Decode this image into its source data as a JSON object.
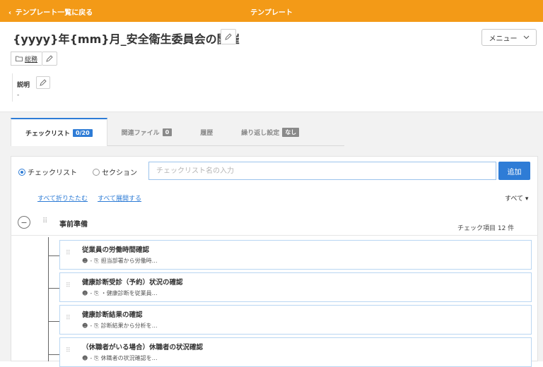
{
  "header": {
    "back_label": "テンプレート一覧に戻る",
    "center_title": "テンプレート"
  },
  "template": {
    "title": "{yyyy}年{mm}月_安全衛生委員会の開催",
    "menu_label": "メニュー",
    "category_label": "総務",
    "description_label": "説明",
    "description_value": "-"
  },
  "tabs": [
    {
      "label": "チェックリスト",
      "badge": "0/20"
    },
    {
      "label": "関連ファイル",
      "badge": "0"
    },
    {
      "label": "履歴",
      "badge": ""
    },
    {
      "label": "繰り返し設定",
      "badge": "なし"
    }
  ],
  "add_form": {
    "radio_checklist": "チェックリスト",
    "radio_section": "セクション",
    "selected": "チェックリスト",
    "input_placeholder": "チェックリスト名の入力",
    "input_value": "",
    "add_label": "追加"
  },
  "list_controls": {
    "collapse_all": "すべて折りたたむ",
    "expand_all": "すべて展開する",
    "filter_label": "すべて"
  },
  "section": {
    "collapse_symbol": "−",
    "title": "事前準備",
    "count_label": "チェック項目 12 件"
  },
  "items": [
    {
      "title": "従業員の労働時間確認",
      "assignee": "-",
      "note": "担当部署から労働時…"
    },
    {
      "title": "健康診断受診（予約）状況の確認",
      "assignee": "-",
      "note": "・健康診断を従業員…"
    },
    {
      "title": "健康診断結果の確認",
      "assignee": "-",
      "note": "診断結果から分析を…"
    },
    {
      "title": "（休職者がいる場合）休職者の状況確認",
      "assignee": "-",
      "note": "休職者の状況確認を…"
    }
  ],
  "colors": {
    "header_bg": "#f39a17",
    "accent": "#2e7cd6"
  }
}
